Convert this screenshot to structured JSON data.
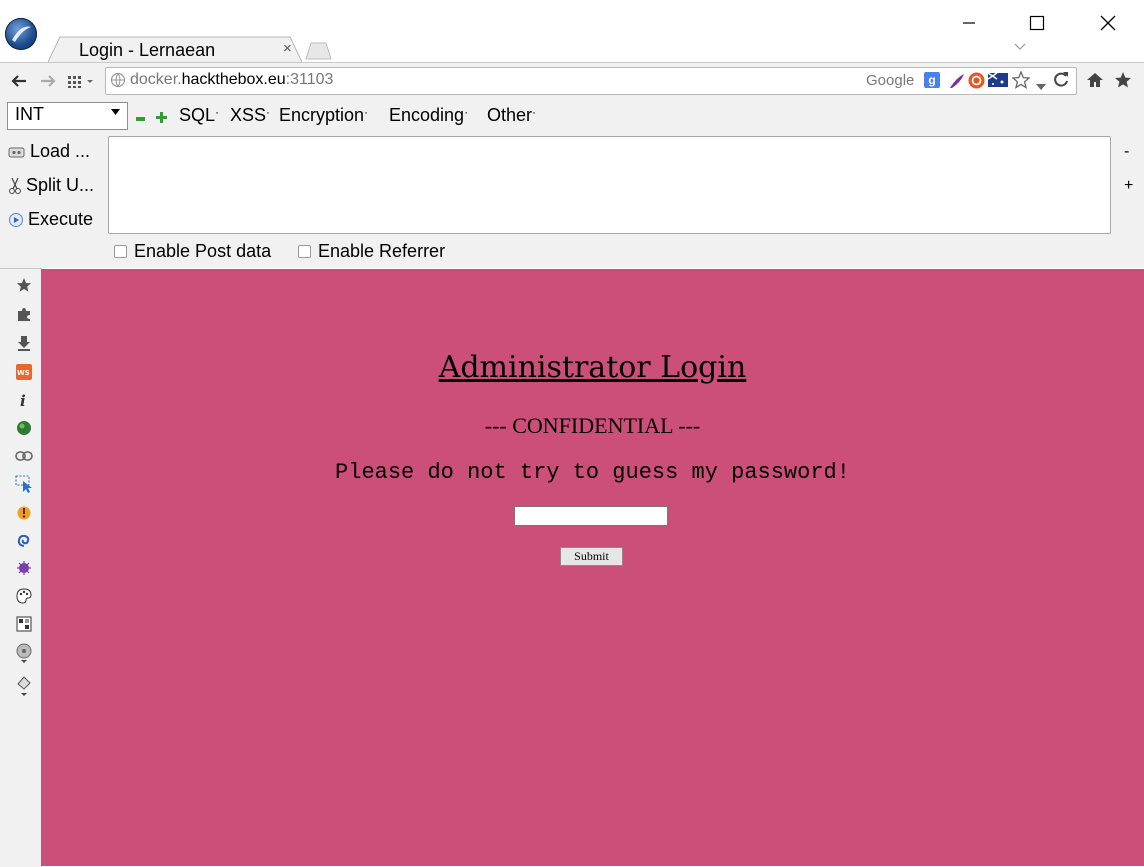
{
  "browser": {
    "tab_title": "Login - Lernaean",
    "tab_close": "×",
    "url_host_prefix": "docker.",
    "url_host": "hackthebox.eu",
    "url_port": ":31103",
    "search_engine": "Google"
  },
  "hackbar": {
    "select_value": "INT",
    "menus": [
      "SQL",
      "XSS",
      "Encryption",
      "Encoding",
      "Other"
    ],
    "menu_dot": "·",
    "load_label": "Load ...",
    "split_label": "Split U...",
    "execute_label": "Execute",
    "minus": "-",
    "plus": "+",
    "enable_post": "Enable Post data",
    "enable_referrer": "Enable Referrer"
  },
  "page": {
    "title": "Administrator Login",
    "subtitle": "--- CONFIDENTIAL ---",
    "message": "Please do not try to guess my password!",
    "submit_label": "Submit",
    "background": "#cc4f79"
  },
  "icons": {
    "ext_bar": [
      "star-icon",
      "puzzle-icon",
      "download-icon",
      "web-developer-icon",
      "info-icon",
      "green-globe-icon",
      "link-icon",
      "cursor-select-icon",
      "firebug-icon",
      "swirl-icon",
      "bug-icon",
      "palette-icon",
      "grid-icon",
      "disk-icon",
      "pen-icon"
    ]
  }
}
